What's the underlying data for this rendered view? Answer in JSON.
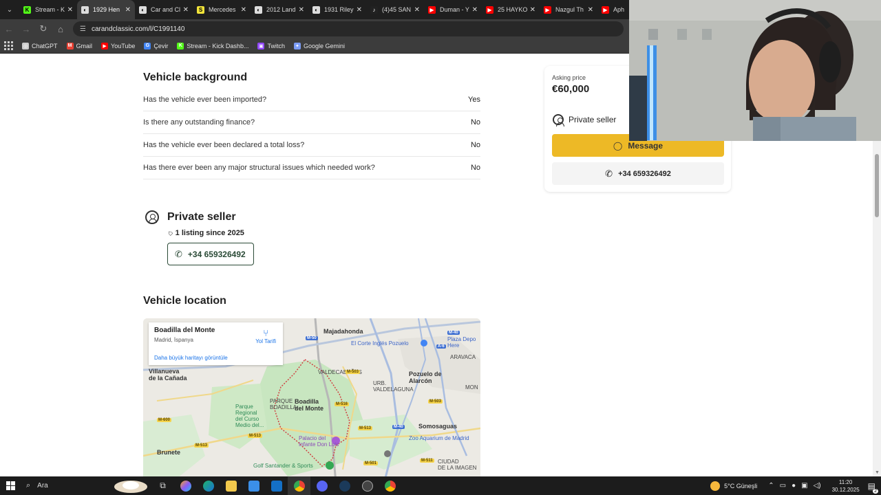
{
  "browser": {
    "tabs": [
      {
        "label": "Stream - K",
        "fav_color": "#53fc18",
        "fav_text": "K"
      },
      {
        "label": "1929 Hen",
        "fav_color": "#dddddd",
        "fav_text": "◐",
        "active": true
      },
      {
        "label": "Car and Cl",
        "fav_color": "#dddddd",
        "fav_text": "◐"
      },
      {
        "label": "Mercedes",
        "fav_color": "#f2e43a",
        "fav_text": "S"
      },
      {
        "label": "2012 Land",
        "fav_color": "#dddddd",
        "fav_text": "◐"
      },
      {
        "label": "1931 Riley",
        "fav_color": "#dddddd",
        "fav_text": "◐"
      },
      {
        "label": "(4)45 SAN",
        "fav_color": "#222222",
        "fav_text": "♪"
      },
      {
        "label": "Duman - Y",
        "fav_color": "#ff0000",
        "fav_text": "▶"
      },
      {
        "label": "25 HAYKO",
        "fav_color": "#ff0000",
        "fav_text": "▶"
      },
      {
        "label": "Nazgul Th",
        "fav_color": "#ff0000",
        "fav_text": "▶"
      },
      {
        "label": "Aph",
        "fav_color": "#ff0000",
        "fav_text": "▶"
      }
    ],
    "url": "carandclassic.com/l/C1991140",
    "bookmarks": [
      {
        "label": "ChatGPT",
        "fav_color": "#cccccc",
        "fav_text": "◎"
      },
      {
        "label": "Gmail",
        "fav_color": "#ea4335",
        "fav_text": "M"
      },
      {
        "label": "YouTube",
        "fav_color": "#ff0000",
        "fav_text": "▶"
      },
      {
        "label": "Çevir",
        "fav_color": "#4285f4",
        "fav_text": "G"
      },
      {
        "label": "Stream - Kick Dashb...",
        "fav_color": "#53fc18",
        "fav_text": "K"
      },
      {
        "label": "Twitch",
        "fav_color": "#9146ff",
        "fav_text": "▣"
      },
      {
        "label": "Google Gemini",
        "fav_color": "#7b9cf5",
        "fav_text": "✦"
      }
    ]
  },
  "vehicle_background": {
    "title": "Vehicle background",
    "questions": [
      {
        "q": "Has the vehicle ever been imported?",
        "a": "Yes"
      },
      {
        "q": "Is there any outstanding finance?",
        "a": "No"
      },
      {
        "q": "Has the vehicle ever been declared a total loss?",
        "a": "No"
      },
      {
        "q": "Has there ever been any major structural issues which needed work?",
        "a": "No"
      }
    ]
  },
  "seller": {
    "title": "Private seller",
    "listing_info": "1 listing since 2025",
    "phone": "+34 659326492"
  },
  "location": {
    "title": "Vehicle location",
    "infobox": {
      "place": "Boadilla del Monte",
      "region": "Madrid, İspanya",
      "directions": "Yol Tarifi",
      "larger_map": "Daha büyük haritayı görüntüle"
    }
  },
  "price_card": {
    "asking_label": "Asking price",
    "price": "€60,000",
    "seller_type": "Private seller",
    "message_label": "Message",
    "phone": "+34 659326492"
  },
  "taskbar": {
    "search_label": "Ara",
    "weather": "5°C  Güneşli",
    "time": "11:20",
    "date": "30.12.2025",
    "notifications": "2"
  }
}
